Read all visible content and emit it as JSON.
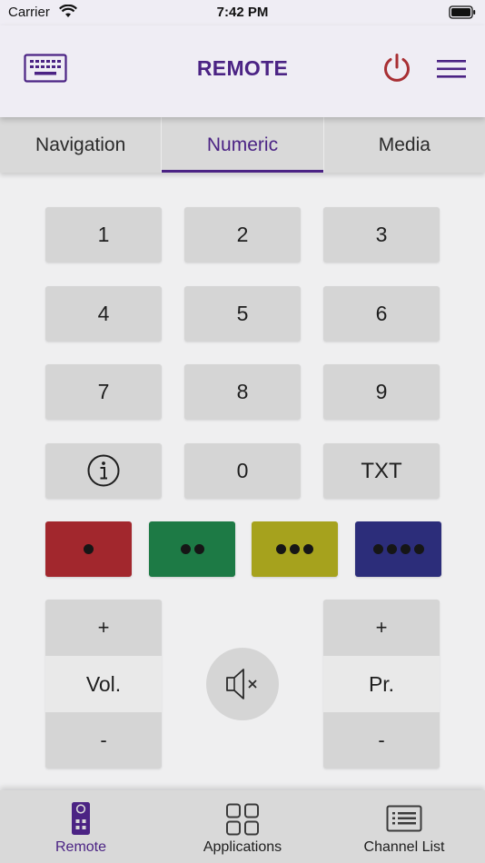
{
  "status": {
    "carrier": "Carrier",
    "time": "7:42 PM"
  },
  "header": {
    "title": "REMOTE",
    "accent_color": "#4b2384",
    "power_color": "#a82f33"
  },
  "tabs": [
    {
      "label": "Navigation",
      "active": false
    },
    {
      "label": "Numeric",
      "active": true
    },
    {
      "label": "Media",
      "active": false
    }
  ],
  "keypad": {
    "k1": "1",
    "k2": "2",
    "k3": "3",
    "k4": "4",
    "k5": "5",
    "k6": "6",
    "k7": "7",
    "k8": "8",
    "k9": "9",
    "k0": "0",
    "txt": "TXT"
  },
  "color_keys": [
    {
      "color": "#a2272d",
      "dots": 1
    },
    {
      "color": "#1d7a45",
      "dots": 2
    },
    {
      "color": "#a6a21d",
      "dots": 3
    },
    {
      "color": "#2c2d7a",
      "dots": 4
    }
  ],
  "volume": {
    "plus": "+",
    "label": "Vol.",
    "minus": "-"
  },
  "program": {
    "plus": "+",
    "label": "Pr.",
    "minus": "-"
  },
  "bottom_nav": [
    {
      "label": "Remote",
      "active": true
    },
    {
      "label": "Applications",
      "active": false
    },
    {
      "label": "Channel List",
      "active": false
    }
  ]
}
